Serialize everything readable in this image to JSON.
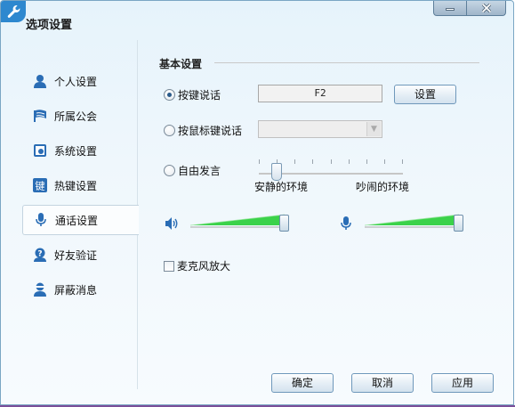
{
  "window": {
    "title": "选项设置",
    "minimize_icon": "minimize-icon",
    "close_icon": "close-icon",
    "app_icon": "wrench-icon"
  },
  "sidebar": {
    "active_index": 4,
    "items": [
      {
        "label": "个人设置",
        "icon": "person-icon"
      },
      {
        "label": "所属公会",
        "icon": "flag-icon"
      },
      {
        "label": "系统设置",
        "icon": "system-settings-icon"
      },
      {
        "label": "热键设置",
        "icon": "hotkey-icon"
      },
      {
        "label": "通话设置",
        "icon": "microphone-icon"
      },
      {
        "label": "好友验证",
        "icon": "friend-verify-icon"
      },
      {
        "label": "屏蔽消息",
        "icon": "block-user-icon"
      }
    ]
  },
  "basic": {
    "section_title": "基本设置",
    "push_to_talk": {
      "label": "按键说话",
      "checked": true,
      "key": "F2",
      "set_button": "设置"
    },
    "mouse_talk": {
      "label": "按鼠标键说话",
      "checked": false,
      "selected": ""
    },
    "free_talk": {
      "label": "自由发言",
      "checked": false,
      "quiet_label": "安静的环境",
      "noisy_label": "吵闹的环境",
      "level": 0.12
    },
    "speaker_volume": {
      "icon": "speaker-icon",
      "level": 0.95
    },
    "mic_volume": {
      "icon": "microphone-icon",
      "level": 0.95
    },
    "mic_boost": {
      "label": "麦克风放大",
      "checked": false
    }
  },
  "footer": {
    "ok": "确定",
    "cancel": "取消",
    "apply": "应用"
  },
  "colors": {
    "accent": "#2e88cf",
    "volume_fill": "#3bd24a",
    "icon_blue": "#2a6db5"
  }
}
